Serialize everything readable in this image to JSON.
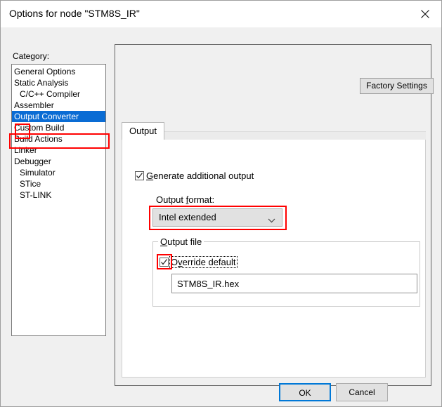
{
  "window": {
    "title": "Options for node \"STM8S_IR\"",
    "close_icon": "close-icon"
  },
  "sidebar": {
    "label": "Category:",
    "items": [
      {
        "label": "General Options",
        "indent": false,
        "selected": false
      },
      {
        "label": "Static Analysis",
        "indent": false,
        "selected": false
      },
      {
        "label": "C/C++ Compiler",
        "indent": true,
        "selected": false
      },
      {
        "label": "Assembler",
        "indent": false,
        "selected": false
      },
      {
        "label": "Output Converter",
        "indent": false,
        "selected": true
      },
      {
        "label": "Custom Build",
        "indent": false,
        "selected": false
      },
      {
        "label": "Build Actions",
        "indent": false,
        "selected": false
      },
      {
        "label": "Linker",
        "indent": false,
        "selected": false
      },
      {
        "label": "Debugger",
        "indent": false,
        "selected": false
      },
      {
        "label": "Simulator",
        "indent": true,
        "selected": false
      },
      {
        "label": "STice",
        "indent": true,
        "selected": false
      },
      {
        "label": "ST-LINK",
        "indent": true,
        "selected": false
      }
    ]
  },
  "panel": {
    "factory_settings_label": "Factory Settings",
    "tabs": [
      {
        "label": "Output",
        "selected": true
      }
    ],
    "generate_additional_output": {
      "label_prefix": "",
      "label_accel": "G",
      "label_suffix": "enerate additional output",
      "checked": true
    },
    "output_format": {
      "label_prefix": "Output ",
      "label_accel": "f",
      "label_suffix": "ormat:",
      "selected_value": "Intel extended",
      "options": [
        "Intel extended"
      ],
      "arrow_icon": "chevron-down-icon"
    },
    "output_file_group": {
      "title_accel": "O",
      "title_suffix": "utput file",
      "override_default": {
        "label_prefix": "O",
        "label_accel": "v",
        "label_suffix": "erride default",
        "checked": true,
        "focused": true
      },
      "filename_value": "STM8S_IR.hex",
      "filename_placeholder": ""
    }
  },
  "footer": {
    "ok_label": "OK",
    "cancel_label": "Cancel"
  },
  "colors": {
    "selection_blue": "#0A6CD4",
    "focus_blue": "#0078D7",
    "annotation_red": "#FF0000",
    "dialog_background": "#F0F0F0"
  }
}
